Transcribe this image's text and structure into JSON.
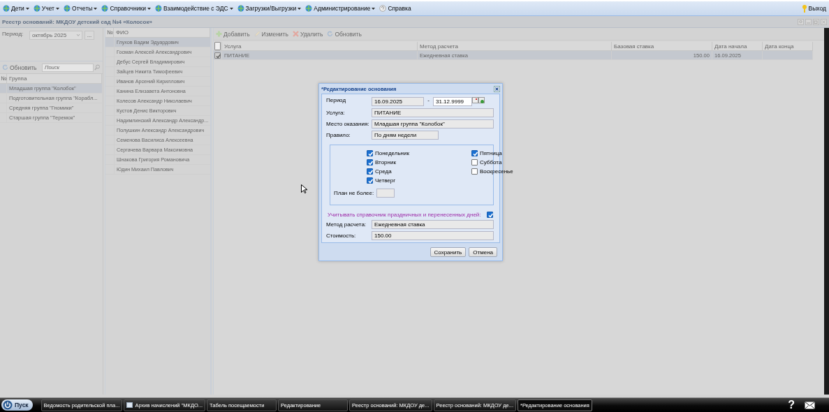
{
  "menu": {
    "items": [
      {
        "label": "Дети",
        "kind": "dropdown"
      },
      {
        "label": "Учет",
        "kind": "dropdown"
      },
      {
        "label": "Отчеты",
        "kind": "dropdown"
      },
      {
        "label": "Справочники",
        "kind": "dropdown"
      },
      {
        "label": "Взаимодействие с ЭДС",
        "kind": "dropdown"
      },
      {
        "label": "Загрузки/Выгрузки",
        "kind": "dropdown"
      },
      {
        "label": "Администрирование",
        "kind": "dropdown"
      },
      {
        "label": "Справка",
        "kind": "link"
      }
    ],
    "exit": "Выход"
  },
  "window": {
    "title": "Реестр оснований: МКДОУ детский сад №4 «Колосок»"
  },
  "left_panel": {
    "period_label": "Период:",
    "period_value": "октябрь 2025",
    "period_more": "...",
    "refresh": "Обновить",
    "search_placeholder": "Поиск",
    "columns": [
      "№",
      "Группа"
    ],
    "groups": [
      {
        "name": "Младшая группа \"Колобок\"",
        "selected": true
      },
      {
        "name": "Подготовительная группа \"Корабл...",
        "selected": false
      },
      {
        "name": "Средняя группа \"Гномики\"",
        "selected": false
      },
      {
        "name": "Старшая группа \"Теремок\"",
        "selected": false
      }
    ]
  },
  "people_panel": {
    "columns": [
      "№",
      "ФИО"
    ],
    "people": [
      {
        "name": "Глухов Вадим Эдуардович",
        "selected": true
      },
      {
        "name": "Госман Алексей Александрович",
        "selected": false
      },
      {
        "name": "Дебус Сергей Владимирович",
        "selected": false
      },
      {
        "name": "Зайцев Никита Тимофеевич",
        "selected": false
      },
      {
        "name": "Иванов Арсений Кириллович",
        "selected": false
      },
      {
        "name": "Канина Елизавета Антоновна",
        "selected": false
      },
      {
        "name": "Колесов Александр Николаевич",
        "selected": false
      },
      {
        "name": "Кустов Денис Викторович",
        "selected": false
      },
      {
        "name": "Надимлинский Александр Александр...",
        "selected": false
      },
      {
        "name": "Полушкин Александр Александрович",
        "selected": false
      },
      {
        "name": "Семенова Василиса Алексеевна",
        "selected": false
      },
      {
        "name": "Сергачева Варвара Максимовна",
        "selected": false
      },
      {
        "name": "Шнакова Григория Романовича",
        "selected": false
      },
      {
        "name": "Юдин Михаил Павлович",
        "selected": false
      }
    ]
  },
  "basis_panel": {
    "toolbar": [
      {
        "label": "Добавить",
        "kind": "add"
      },
      {
        "label": "Изменить",
        "kind": "edit"
      },
      {
        "label": "Удалить",
        "kind": "delete"
      },
      {
        "label": "Обновить",
        "kind": "refresh"
      }
    ],
    "select_all_checked": false,
    "columns": [
      "Услуга",
      "Метод расчета",
      "Базовая ставка",
      "Дата начала",
      "Дата конца"
    ],
    "rows": [
      {
        "checked": true,
        "selected": true,
        "cells": [
          "ПИТАНИЕ",
          "Ежедневная ставка",
          "150.00",
          "16.09.2025"
        ]
      }
    ]
  },
  "dialog": {
    "title": "*Редактирование основания",
    "period_label": "Период",
    "period_from": "16.09.2025",
    "period_dash": "-",
    "period_to": "31.12.9999",
    "service_label": "Услуга:",
    "service": "ПИТАНИЕ",
    "place_label": "Место оказания:",
    "place": "Младшая группа \"Колобок\"",
    "rule_label": "Правило:",
    "rule": "По дням недели",
    "days": [
      {
        "label": "Понедельник",
        "checked": true
      },
      {
        "label": "Вторник",
        "checked": true
      },
      {
        "label": "Среда",
        "checked": true
      },
      {
        "label": "Четверг",
        "checked": true
      },
      {
        "label": "Пятница",
        "checked": true
      },
      {
        "label": "Суббота",
        "checked": false
      },
      {
        "label": "Воскресенье",
        "checked": false
      }
    ],
    "plan_label": "План не более:",
    "holidays_label": "Учитывать справочник праздничных и перенесенных дней:",
    "holidays_checked": true,
    "method_label": "Метод расчета:",
    "method": "Ежедневная ставка",
    "cost_label": "Стоимость:",
    "cost": "150.00",
    "buttons": [
      "Сохранить",
      "Отмена"
    ]
  },
  "taskbar": {
    "start": "Пуск",
    "tasks": [
      {
        "label": "Ведомость родительской пла...",
        "selected": false,
        "icon": false
      },
      {
        "label": "Архив начислений \"МКДО...",
        "selected": false,
        "icon": true
      },
      {
        "label": "Табель посещаемости",
        "selected": false,
        "icon": false
      },
      {
        "label": "Редактирование",
        "selected": false,
        "icon": false
      },
      {
        "label": "Реестр оснований: МКДОУ де...",
        "selected": false,
        "icon": false
      },
      {
        "label": "Реестр оснований: МКДОУ де...",
        "selected": false,
        "icon": false
      },
      {
        "label": "*Редактирование основания",
        "selected": true,
        "icon": false
      }
    ],
    "help": "?"
  }
}
